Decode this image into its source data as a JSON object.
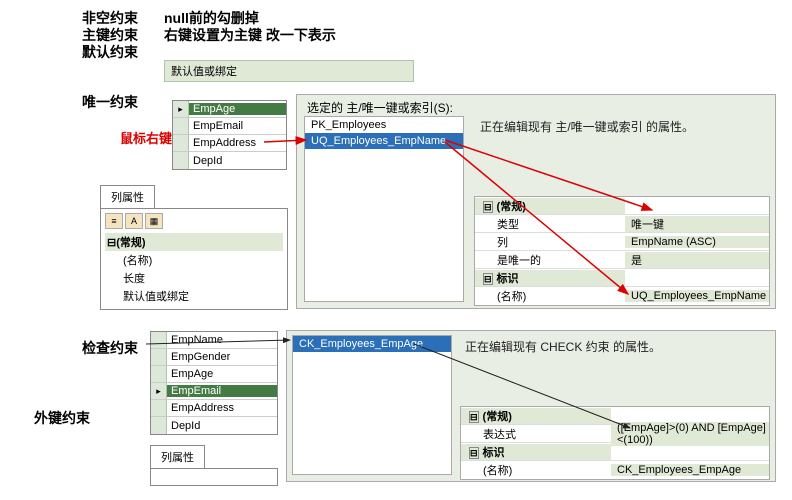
{
  "notes": {
    "nonnull": "非空约束",
    "nonnull_desc": "null前的勾删掉",
    "pk": "主键约束",
    "pk_desc": "右键设置为主键 改一下表示",
    "default": "默认约束",
    "unique": "唯一约束",
    "check": "检查约束",
    "foreign": "外键约束",
    "mouse": "鼠标右键",
    "default_bind": "默认值或绑定"
  },
  "fields1": [
    {
      "name": "EmpAge",
      "sel": true,
      "key": "▸"
    },
    {
      "name": "EmpEmail",
      "sel": false,
      "key": ""
    },
    {
      "name": "EmpAddress",
      "sel": false,
      "key": ""
    },
    {
      "name": "DepId",
      "sel": false,
      "key": ""
    }
  ],
  "fields2": [
    {
      "name": "EmpName",
      "sel": false,
      "key": ""
    },
    {
      "name": "EmpGender",
      "sel": false,
      "key": ""
    },
    {
      "name": "EmpAge",
      "sel": false,
      "key": ""
    },
    {
      "name": "EmpEmail",
      "sel": true,
      "key": "▸"
    },
    {
      "name": "EmpAddress",
      "sel": false,
      "key": ""
    },
    {
      "name": "DepId",
      "sel": false,
      "key": ""
    }
  ],
  "colprop": {
    "tab": "列属性",
    "group": "(常规)",
    "items": [
      "(名称)",
      "长度",
      "默认值或绑定"
    ]
  },
  "uq": {
    "caption": "选定的 主/唯一键或索引(S):",
    "list": [
      {
        "name": "PK_Employees",
        "sel": false
      },
      {
        "name": "UQ_Employees_EmpName",
        "sel": true
      }
    ],
    "desc": "正在编辑现有 主/唯一键或索引 的属性。",
    "grid": [
      {
        "type": "hdr",
        "toggle": "⊟",
        "k": "(常规)",
        "v": ""
      },
      {
        "type": "sub",
        "k": "类型",
        "v": "唯一键"
      },
      {
        "type": "sub",
        "k": "列",
        "v": "EmpName (ASC)"
      },
      {
        "type": "sub",
        "k": "是唯一的",
        "v": "是"
      },
      {
        "type": "hdr",
        "toggle": "⊟",
        "k": "标识",
        "v": ""
      },
      {
        "type": "sub",
        "k": "(名称)",
        "v": "UQ_Employees_EmpName"
      }
    ]
  },
  "ck": {
    "list": [
      {
        "name": "CK_Employees_EmpAge",
        "sel": true
      }
    ],
    "desc": "正在编辑现有 CHECK 约束 的属性。",
    "grid": [
      {
        "type": "hdr",
        "toggle": "⊟",
        "k": "(常规)",
        "v": ""
      },
      {
        "type": "sub",
        "k": "表达式",
        "v": "([EmpAge]>(0) AND [EmpAge]<(100))"
      },
      {
        "type": "hdr",
        "toggle": "⊟",
        "k": "标识",
        "v": ""
      },
      {
        "type": "sub",
        "k": "(名称)",
        "v": "CK_Employees_EmpAge"
      }
    ]
  },
  "colprop2_tab": "列属性"
}
